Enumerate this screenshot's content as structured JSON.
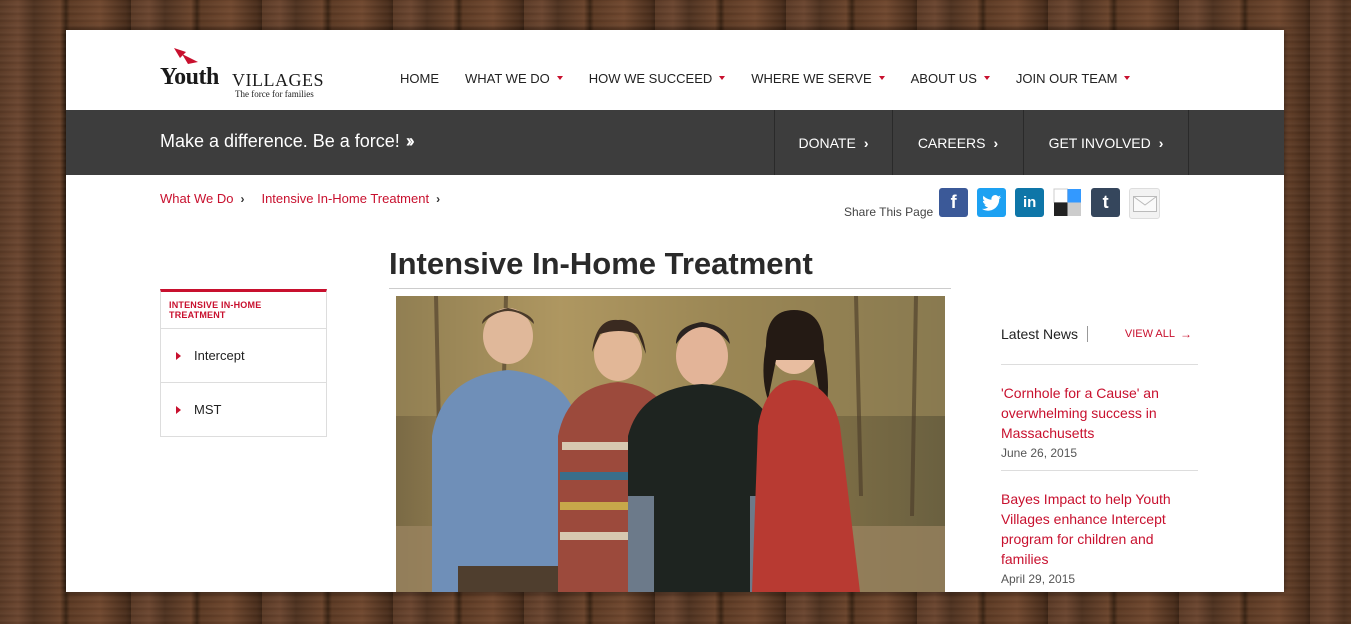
{
  "logo": {
    "word1": "Youth",
    "word2": "VILLAGES",
    "tagline": "The force for families"
  },
  "nav": {
    "items": [
      {
        "label": "HOME",
        "caret": false
      },
      {
        "label": "WHAT WE DO",
        "caret": true
      },
      {
        "label": "HOW WE SUCCEED",
        "caret": true
      },
      {
        "label": "WHERE WE SERVE",
        "caret": true
      },
      {
        "label": "ABOUT US",
        "caret": true
      },
      {
        "label": "JOIN OUR TEAM",
        "caret": true
      }
    ]
  },
  "band": {
    "slogan": "Make a difference. Be a force!",
    "slogan_icon": "double-chevron-right-icon",
    "links": [
      {
        "label": "DONATE"
      },
      {
        "label": "CAREERS"
      },
      {
        "label": "GET INVOLVED"
      }
    ]
  },
  "breadcrumb": [
    {
      "label": "What We Do"
    },
    {
      "label": "Intensive In-Home Treatment"
    }
  ],
  "share": {
    "label": "Share This Page",
    "icons": [
      {
        "name": "facebook-icon",
        "color": "#3b5998"
      },
      {
        "name": "twitter-icon",
        "color": "#1da1f2"
      },
      {
        "name": "linkedin-icon",
        "color": "#0e76a8"
      },
      {
        "name": "delicious-icon",
        "color": "#3399ff"
      },
      {
        "name": "tumblr-icon",
        "color": "#35465c"
      },
      {
        "name": "email-icon",
        "color": "#e8e8e8"
      }
    ]
  },
  "subnav": {
    "title": "INTENSIVE IN-HOME TREATMENT",
    "items": [
      {
        "label": "Intercept"
      },
      {
        "label": "MST"
      }
    ]
  },
  "main": {
    "title": "Intensive In-Home Treatment"
  },
  "news": {
    "title": "Latest News",
    "view_all": "VIEW ALL",
    "items": [
      {
        "title": "'Cornhole for a Cause' an overwhelming success in Massachusetts",
        "date": "June 26, 2015"
      },
      {
        "title": "Bayes Impact to help Youth Villages enhance Intercept program for children and families",
        "date": "April 29, 2015"
      }
    ]
  },
  "colors": {
    "accent": "#c8102e",
    "band": "#3d3d3d"
  }
}
